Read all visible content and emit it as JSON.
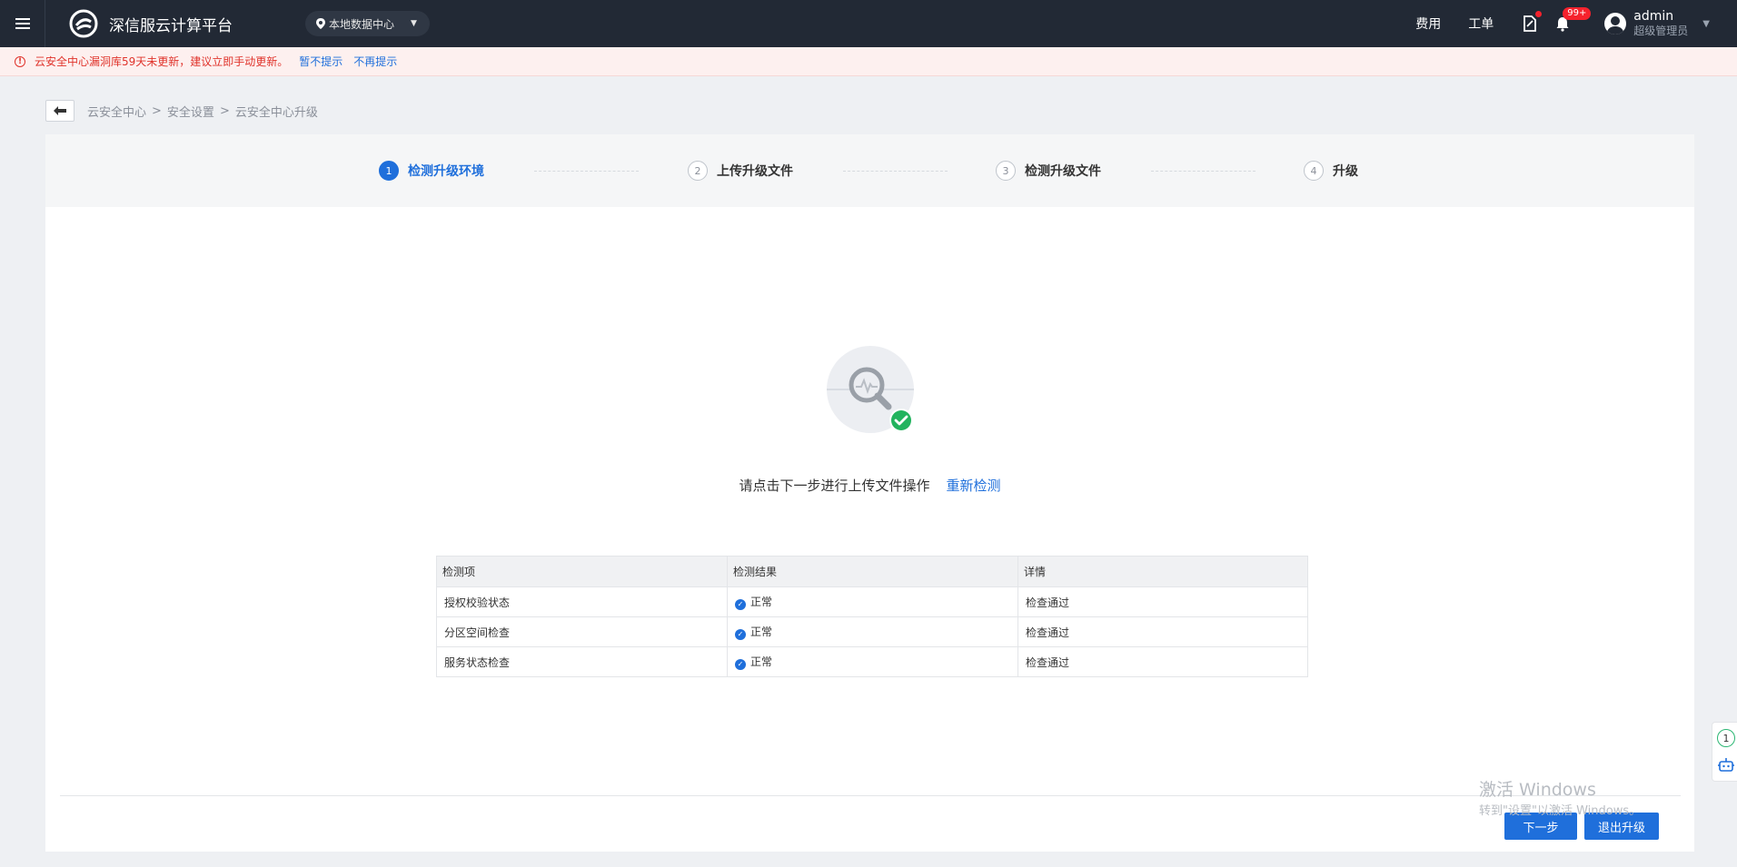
{
  "header": {
    "brand_title": "深信服云计算平台",
    "datacenter": "本地数据中心",
    "links": {
      "fees": "费用",
      "tickets": "工单"
    },
    "notification_badge": "99+",
    "user": {
      "name": "admin",
      "role": "超级管理员"
    }
  },
  "alert": {
    "message": "云安全中心漏洞库59天未更新，建议立即手动更新。",
    "link_later": "暂不提示",
    "link_never": "不再提示"
  },
  "breadcrumb": {
    "items": [
      "云安全中心",
      "安全设置",
      "云安全中心升级"
    ],
    "separator": ">"
  },
  "steps": [
    {
      "num": "1",
      "label": "检测升级环境",
      "active": true
    },
    {
      "num": "2",
      "label": "上传升级文件",
      "active": false
    },
    {
      "num": "3",
      "label": "检测升级文件",
      "active": false
    },
    {
      "num": "4",
      "label": "升级",
      "active": false
    }
  ],
  "result": {
    "message": "请点击下一步进行上传文件操作",
    "retest_link": "重新检测"
  },
  "table": {
    "headers": [
      "检测项",
      "检测结果",
      "详情"
    ],
    "rows": [
      {
        "item": "授权校验状态",
        "result": "正常",
        "detail": "检查通过"
      },
      {
        "item": "分区空间检查",
        "result": "正常",
        "detail": "检查通过"
      },
      {
        "item": "服务状态检查",
        "result": "正常",
        "detail": "检查通过"
      }
    ]
  },
  "buttons": {
    "next": "下一步",
    "exit": "退出升级"
  },
  "watermark": {
    "line1": "激活 Windows",
    "line2": "转到\"设置\"以激活 Windows。"
  },
  "side_float": {
    "count": "1"
  },
  "colors": {
    "primary": "#1f6fdb",
    "topbar": "#222935",
    "alert_text": "#e0332b",
    "success": "#22b35e"
  }
}
